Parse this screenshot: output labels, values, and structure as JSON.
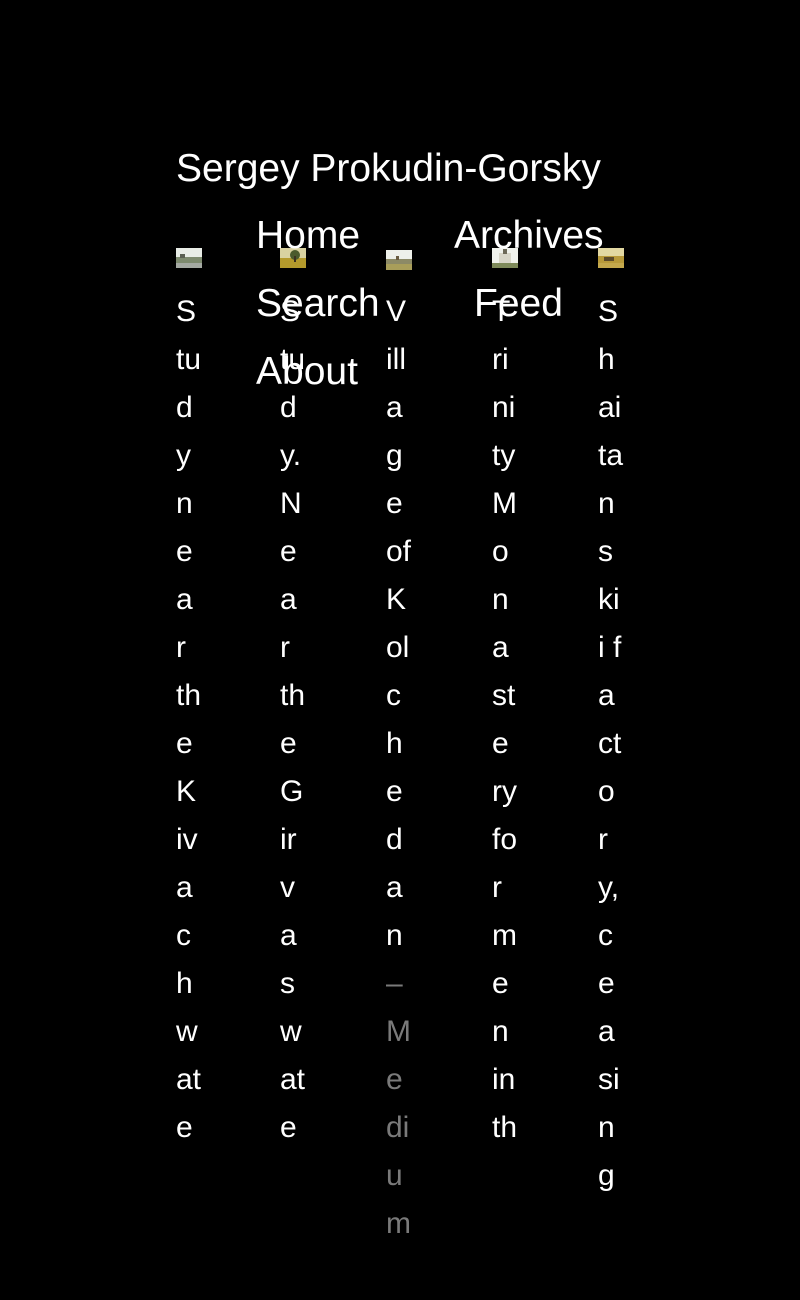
{
  "site": {
    "title": "Sergey Prokudin-Gorsky"
  },
  "nav": {
    "home": "Home",
    "archives": "Archives",
    "search": "Search",
    "feed": "Feed",
    "about": "About"
  },
  "thumbs": [
    {
      "caption": "Study near the Kivachwate",
      "date": ""
    },
    {
      "caption": "Study. Near the Girvaswate",
      "date": ""
    },
    {
      "caption": "Village of Kolchedan",
      "date": " – Medium"
    },
    {
      "caption": "Trinity Monastery for men in th",
      "date": ""
    },
    {
      "caption": "Shaitanskii factory, ceasing",
      "date": ""
    }
  ],
  "colors": {
    "background": "#000000",
    "text": "#ffffff",
    "muted_text": "#7a7a7a"
  }
}
